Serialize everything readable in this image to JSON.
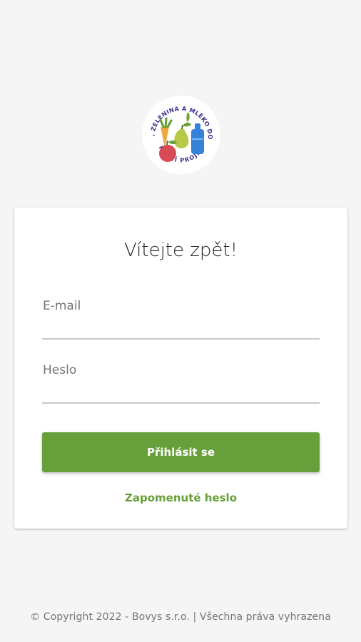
{
  "logo": {
    "ring_text": "OVOCE, ZELENINA A MLÉKO DO ŠKOL",
    "bottom_text": "ŠKOLNÍ PROJEKT"
  },
  "login": {
    "title": "Vítejte zpět!",
    "email_label": "E-mail",
    "password_label": "Heslo",
    "submit_label": "Přihlásit se",
    "forgot_label": "Zapomenuté heslo"
  },
  "footer": {
    "text": "© Copyright 2022 - Bovys s.r.o. | Všechna práva vyhrazena"
  },
  "colors": {
    "accent": "#67a03a",
    "background": "#f5f5f5"
  }
}
